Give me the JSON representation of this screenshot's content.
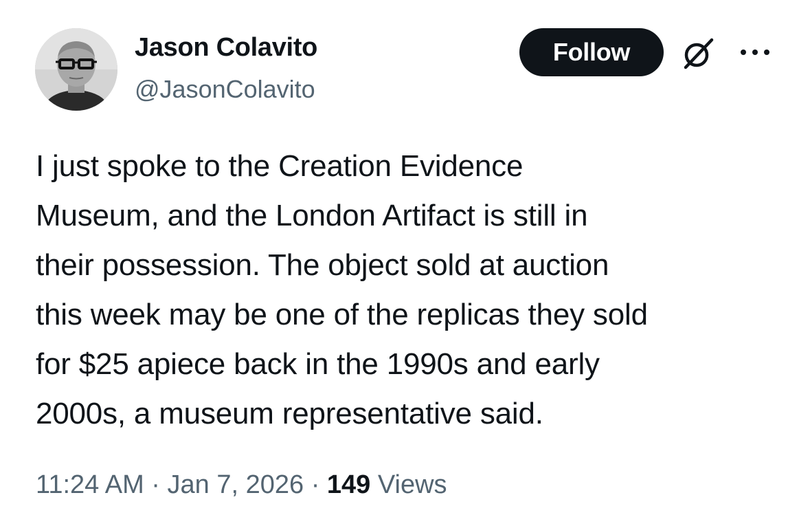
{
  "author": {
    "display_name": "Jason Colavito",
    "handle": "@JasonColavito",
    "avatar_icon": "person-avatar"
  },
  "actions": {
    "follow_label": "Follow",
    "grok_icon": "grok-icon",
    "more_icon": "more-dots-icon"
  },
  "tweet": {
    "lines": [
      "I just spoke to the Creation Evidence",
      "Museum, and the London Artifact is still in",
      "their possession. The object sold at auction",
      "this week may be one of the replicas they sold",
      "for $25 apiece back in the 1990s and early",
      "2000s, a museum representative said."
    ]
  },
  "meta": {
    "time": "11:24 AM",
    "separator": "·",
    "date": "Jan 7, 2026",
    "views_count": "149",
    "views_label": "Views"
  },
  "colors": {
    "text_primary": "#0f1419",
    "text_secondary": "#536471",
    "button_bg": "#0f1419",
    "button_text": "#ffffff"
  }
}
